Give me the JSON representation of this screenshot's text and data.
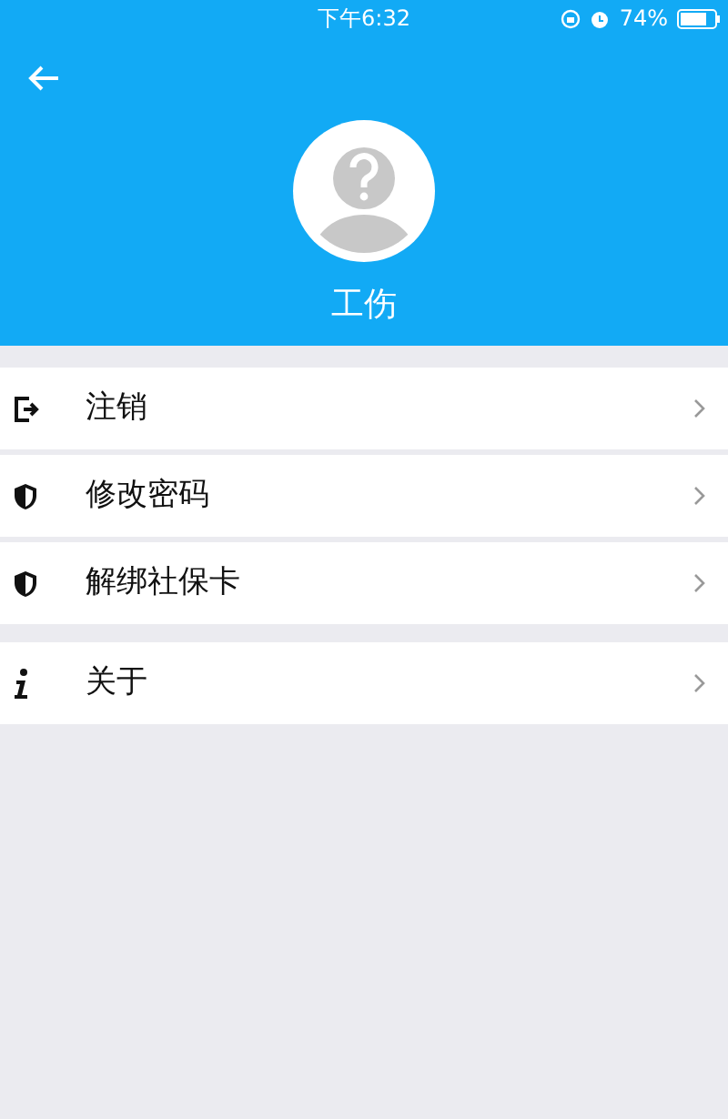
{
  "status_bar": {
    "time": "下午6:32",
    "battery": "74%"
  },
  "profile": {
    "name": "工伤"
  },
  "menu_groups": [
    {
      "items": [
        {
          "kind": "logout",
          "label": "注销"
        },
        {
          "kind": "shield",
          "label": "修改密码"
        },
        {
          "kind": "shield",
          "label": "解绑社保卡"
        }
      ]
    },
    {
      "items": [
        {
          "kind": "info",
          "label": "关于"
        }
      ]
    }
  ]
}
